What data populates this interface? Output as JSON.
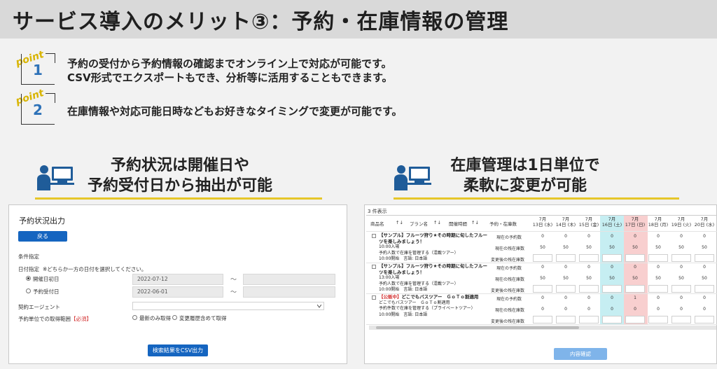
{
  "title": "サービス導入のメリット③：予約・在庫情報の管理",
  "points": [
    {
      "badge": "point",
      "number": "1",
      "lines": [
        "予約の受付から予約情報の確認までオンライン上で対応が可能です。",
        "CSV形式でエクスポートもでき、分析等に活用することもできます。"
      ]
    },
    {
      "badge": "point",
      "number": "2",
      "lines": [
        "在庫情報や対応可能日時などもお好きなタイミングで変更が可能です。"
      ]
    }
  ],
  "features": [
    {
      "lines": [
        "予約状況は開催日や",
        "予約受付日から抽出が可能"
      ]
    },
    {
      "lines": [
        "在庫管理は1日単位で",
        "柔軟に変更が可能"
      ]
    }
  ],
  "colors": {
    "accent_yellow": "#e6c629",
    "button_blue": "#1565c0",
    "icon_blue": "#1f5c99",
    "highlight_cyan": "#c6eef2",
    "highlight_pink": "#f8cfcf"
  },
  "reservation_panel": {
    "title": "予約状況出力",
    "back_button": "戻る",
    "conditions_label": "条件指定",
    "date_label": "日付指定",
    "date_hint": "※どちらか一方の日付を選択してください。",
    "event_date_label": "開催日初日",
    "event_date_value": "2022-07-12",
    "booking_date_label": "予約受付日",
    "booking_date_value": "2022-06-01",
    "tilde": "～",
    "agent_label": "契約エージェント",
    "range_label": "予約単位での取得範囲",
    "required_label": "【必須】",
    "option_latest": "最新のみ取得",
    "option_history": "変更履歴含めて取得",
    "export_button": "検索結果をCSV出力"
  },
  "inventory_panel": {
    "count_label": "3 件表示",
    "headers": {
      "product": "商品名",
      "sort": "↑↓",
      "plan": "プラン名",
      "time": "開催時間",
      "kind": "予約・在庫数"
    },
    "dates": [
      {
        "month": "7月",
        "day": "13日 (水)"
      },
      {
        "month": "7月",
        "day": "14日 (木)"
      },
      {
        "month": "7月",
        "day": "15日 (金)"
      },
      {
        "month": "7月",
        "day": "16日 (土)"
      },
      {
        "month": "7月",
        "day": "17日 (日)"
      },
      {
        "month": "7月",
        "day": "18日 (月)"
      },
      {
        "month": "7月",
        "day": "19日 (火)"
      },
      {
        "month": "7月",
        "day": "20日 (水)"
      }
    ],
    "row_labels": {
      "reserved": "現在の予約数",
      "stock": "現在の残在庫数",
      "changed": "変更後の残在庫数"
    },
    "products": [
      {
        "tag": "",
        "name1": "【サンプル】フルーツ狩り★その時期に旬したフルー",
        "name2": "ツを楽しみましょう！",
        "time": "10:00入場",
        "plan": "予約人数で在庫を管理する（混載ツアー）",
        "lang": "10:00開始　言語: 日本語",
        "reserved": [
          "0",
          "0",
          "0",
          "0",
          "0",
          "0",
          "0",
          "0"
        ],
        "stock": [
          "50",
          "50",
          "50",
          "50",
          "50",
          "50",
          "50",
          "50"
        ]
      },
      {
        "tag": "",
        "name1": "【サンプル】フルーツ狩り★その時期に旬したフルー",
        "name2": "ツを楽しみましょう！",
        "time": "13:00入場",
        "plan": "予約人数で在庫を管理する（混載ツアー）",
        "lang": "10:00開始　言語: 日本語",
        "reserved": [
          "0",
          "0",
          "0",
          "0",
          "0",
          "0",
          "0",
          "0"
        ],
        "stock": [
          "50",
          "50",
          "50",
          "50",
          "50",
          "50",
          "50",
          "50"
        ]
      },
      {
        "tag": "【公販中】",
        "name1": "どこでもバスツアー　ＧｏＴｏ割適用",
        "name2": "どこでもバスツアー　ＧｏＴｏ割適用",
        "time": "",
        "plan": "予約件数で在庫を管理する（プライベートツアー）",
        "lang": "10:00開始　言語: 日本語",
        "reserved": [
          "0",
          "0",
          "0",
          "0",
          "1",
          "0",
          "0",
          "0"
        ],
        "stock": [
          "0",
          "0",
          "0",
          "0",
          "0",
          "0",
          "0",
          "0"
        ]
      }
    ],
    "confirm_button": "内容確認"
  }
}
